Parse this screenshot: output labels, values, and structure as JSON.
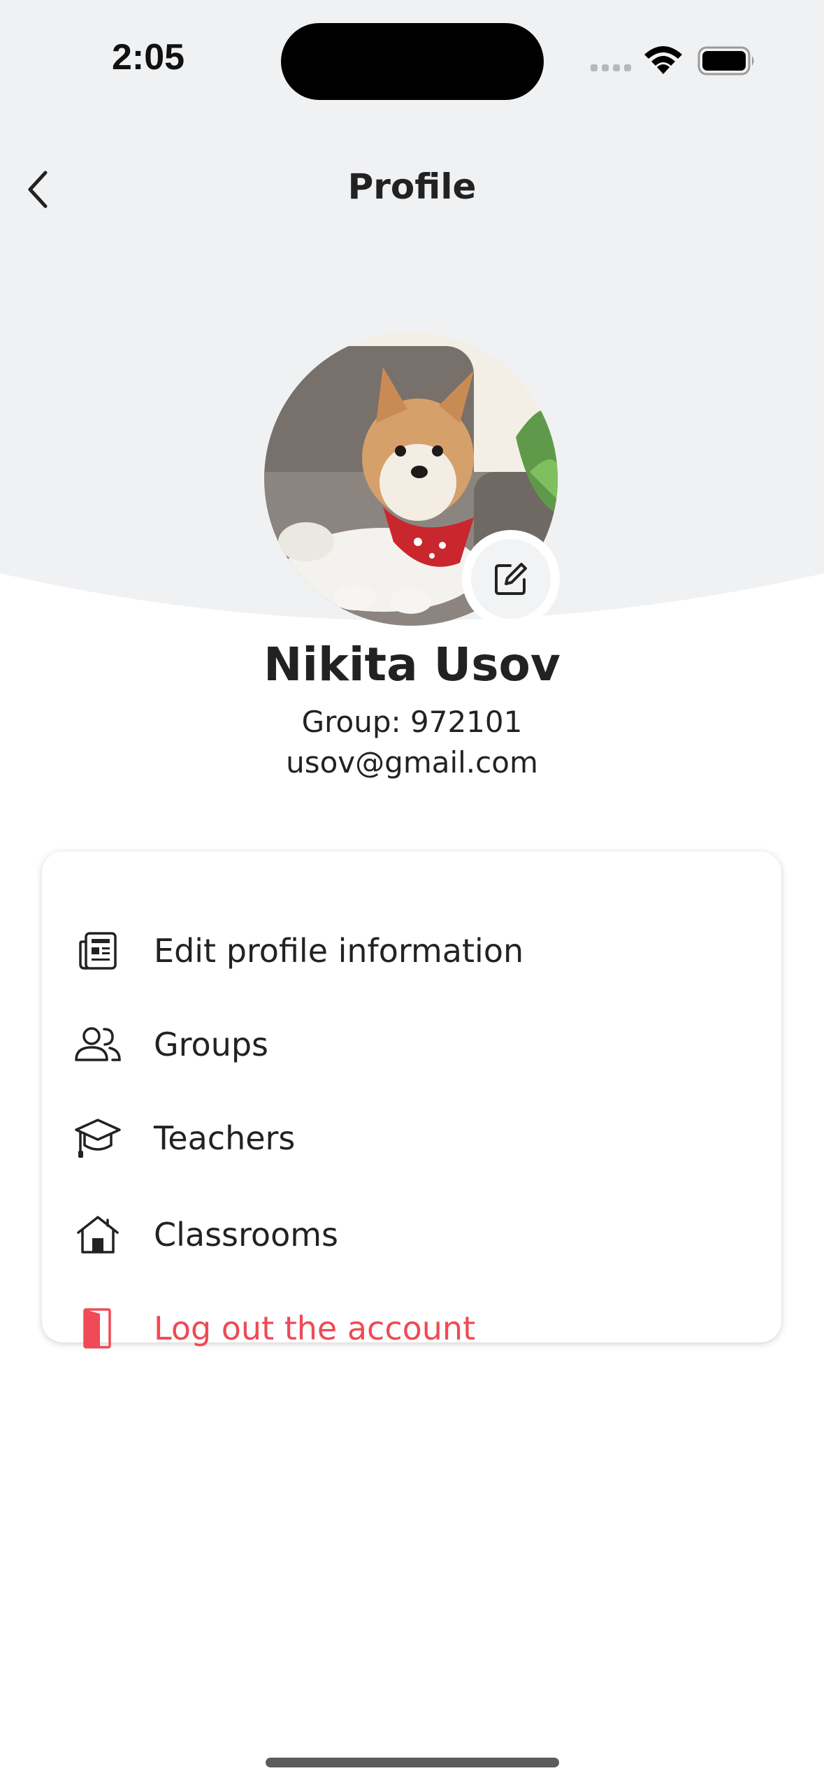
{
  "status_bar": {
    "time": "2:05"
  },
  "header": {
    "title": "Profile",
    "back_icon": "chevron-left-icon"
  },
  "profile": {
    "name": "Nikita Usov",
    "group": "Group: 972101",
    "email": "usov@gmail.com",
    "avatar_description": "dog-photo",
    "edit_icon": "edit-square-icon"
  },
  "menu": {
    "items": [
      {
        "label": "Edit profile information",
        "icon": "news-card-icon"
      },
      {
        "label": "Groups",
        "icon": "users-icon"
      },
      {
        "label": "Teachers",
        "icon": "graduation-cap-icon"
      },
      {
        "label": "Classrooms",
        "icon": "house-icon"
      },
      {
        "label": "Log out the account",
        "icon": "door-exit-icon"
      }
    ]
  },
  "colors": {
    "header_background": "#f0f1f3",
    "danger": "#ef4a55",
    "text": "#222222"
  }
}
